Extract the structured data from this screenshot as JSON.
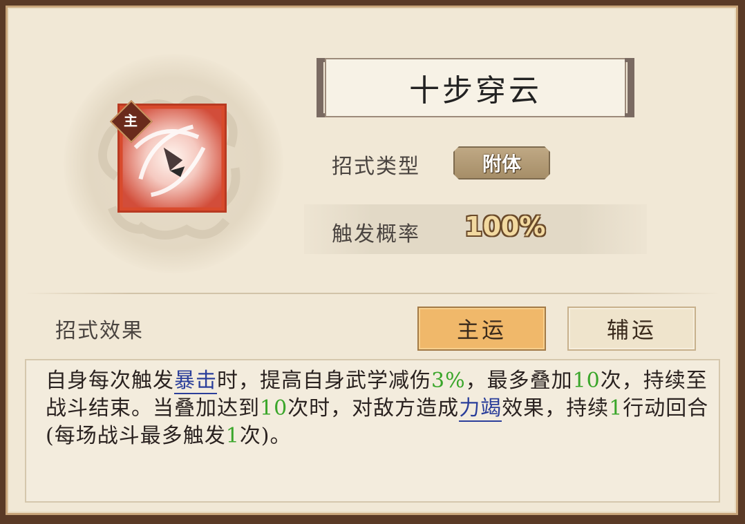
{
  "skill": {
    "name": "十步穿云",
    "badge": "主"
  },
  "info": {
    "type_label": "招式类型",
    "type_value": "附体",
    "rate_label": "触发概率",
    "rate_value": "100%"
  },
  "effect": {
    "section_label": "招式效果",
    "tabs": [
      {
        "label": "主运",
        "selected": true
      },
      {
        "label": "辅运",
        "selected": false
      }
    ],
    "description": [
      {
        "text": "自身每次触发",
        "style": "normal"
      },
      {
        "text": "暴击",
        "style": "link"
      },
      {
        "text": "时，提高自身武学减伤",
        "style": "normal"
      },
      {
        "text": "3%",
        "style": "green"
      },
      {
        "text": "，最多叠加",
        "style": "normal"
      },
      {
        "text": "10",
        "style": "green"
      },
      {
        "text": "次，持续至战斗结束。当叠加达到",
        "style": "normal"
      },
      {
        "text": "10",
        "style": "green"
      },
      {
        "text": "次时，对敌方造成",
        "style": "normal"
      },
      {
        "text": "力竭",
        "style": "link"
      },
      {
        "text": "效果，持续",
        "style": "normal"
      },
      {
        "text": "1",
        "style": "green"
      },
      {
        "text": "行动回合(每场战斗最多触发",
        "style": "normal"
      },
      {
        "text": "1",
        "style": "green"
      },
      {
        "text": "次)。",
        "style": "normal"
      }
    ]
  },
  "colors": {
    "panel_bg": "#f1e8d6",
    "highlight_green": "#3aa62a",
    "link_blue": "#2a3e9a",
    "tab_selected": "#f0b86a"
  }
}
